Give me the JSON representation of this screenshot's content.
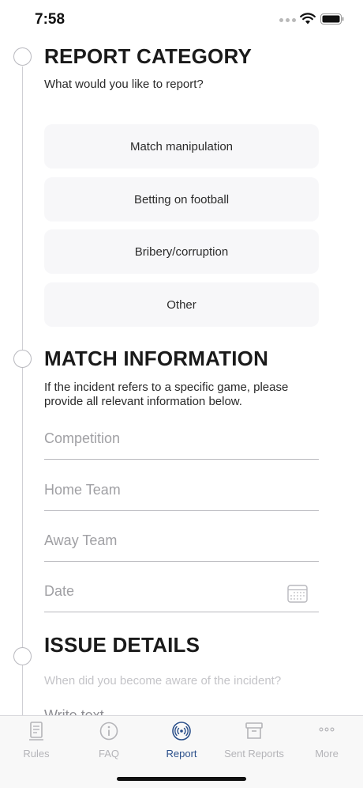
{
  "status_bar": {
    "time": "7:58"
  },
  "report_category": {
    "title": "REPORT CATEGORY",
    "subtitle": "What would you like to report?",
    "options": [
      "Match manipulation",
      "Betting on football",
      "Bribery/corruption",
      "Other"
    ]
  },
  "match_information": {
    "title": "MATCH INFORMATION",
    "subtitle": "If the incident refers to a specific game, please provide all relevant information below.",
    "fields": {
      "competition_placeholder": "Competition",
      "home_team_placeholder": "Home Team",
      "away_team_placeholder": "Away Team",
      "date_placeholder": "Date"
    }
  },
  "issue_details": {
    "title": "ISSUE DETAILS",
    "hint": "When did you become aware of the incident?",
    "text_placeholder": "Write text..."
  },
  "tab_bar": {
    "tabs": [
      {
        "label": "Rules",
        "icon": "rules-icon"
      },
      {
        "label": "FAQ",
        "icon": "info-icon"
      },
      {
        "label": "Report",
        "icon": "report-broadcast-icon"
      },
      {
        "label": "Sent Reports",
        "icon": "archive-box-icon"
      },
      {
        "label": "More",
        "icon": "more-dots-icon"
      }
    ],
    "active_tab": "Report",
    "active_color": "#2a4f8a",
    "inactive_color": "#b4b4b8"
  }
}
